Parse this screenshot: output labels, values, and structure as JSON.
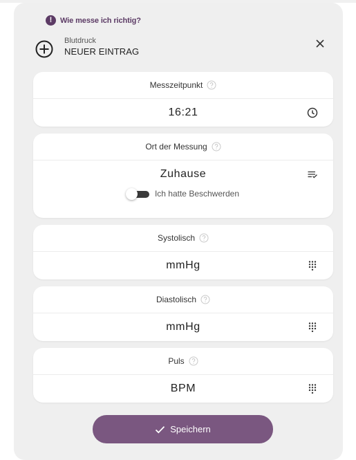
{
  "hint": {
    "text": "Wie messe ich richtig?",
    "icon": "exclamation-circle-icon",
    "icon_glyph": "!"
  },
  "entry": {
    "subtitle": "Blutdruck",
    "title": "NEUER EINTRAG"
  },
  "cards": {
    "time": {
      "label": "Messzeitpunkt",
      "value": "16:21",
      "icon": "clock-icon"
    },
    "location": {
      "label": "Ort der Messung",
      "value": "Zuhause",
      "icon": "list-check-icon",
      "complaints_label": "Ich hatte Beschwerden",
      "complaints_on": false
    },
    "systolic": {
      "label": "Systolisch",
      "unit": "mmHg",
      "icon": "keypad-icon"
    },
    "diastolic": {
      "label": "Diastolisch",
      "unit": "mmHg",
      "icon": "keypad-icon"
    },
    "pulse": {
      "label": "Puls",
      "unit": "BPM",
      "icon": "keypad-icon"
    }
  },
  "save_button": {
    "label": "Speichern"
  },
  "colors": {
    "accent": "#7a5780",
    "accent_dark": "#5c3b65",
    "panel_background": "#efefef",
    "card_background": "#ffffff"
  }
}
